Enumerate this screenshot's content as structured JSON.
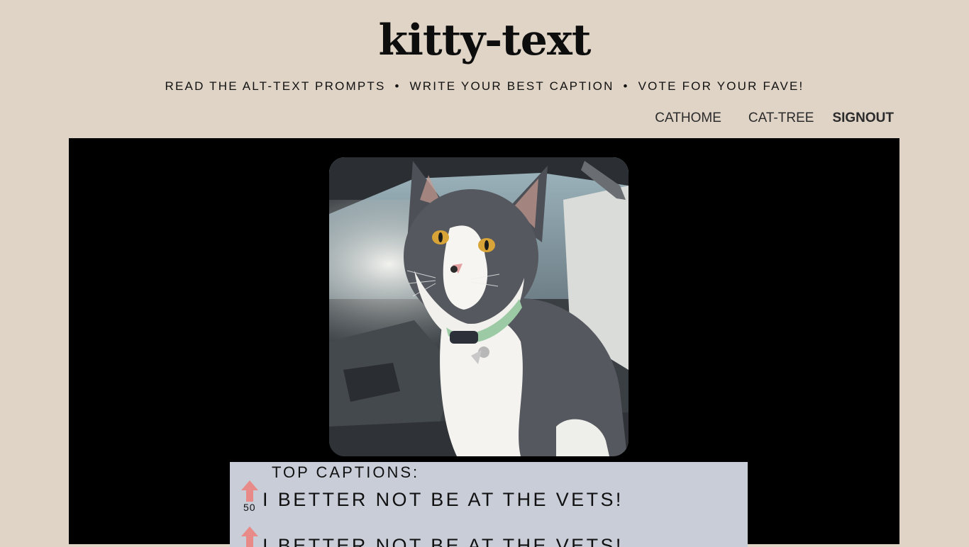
{
  "site": {
    "title": "kitty-text",
    "tagline": {
      "part1": "READ THE ALT-TEXT PROMPTS",
      "part2": "WRITE YOUR BEST CAPTION",
      "part3": "VOTE FOR YOUR FAVE!",
      "separator": "•"
    }
  },
  "nav": {
    "items": [
      {
        "label": "CATHOME"
      },
      {
        "label": "CAT-TREE"
      },
      {
        "label": "SIGNOUT"
      }
    ]
  },
  "photo": {
    "subject": "gray and white cat wearing a collar in a car"
  },
  "captions": {
    "heading": "TOP CAPTIONS:",
    "items": [
      {
        "votes": "50",
        "text": "I BETTER NOT BE AT THE VETS!"
      },
      {
        "votes": "",
        "text": "I BETTER NOT BE AT THE VETS!"
      }
    ]
  },
  "colors": {
    "page_background": "#e0d4c6",
    "stage_background": "#000000",
    "caption_panel": "#c8cdd8",
    "upvote_arrow": "#e88b88"
  }
}
